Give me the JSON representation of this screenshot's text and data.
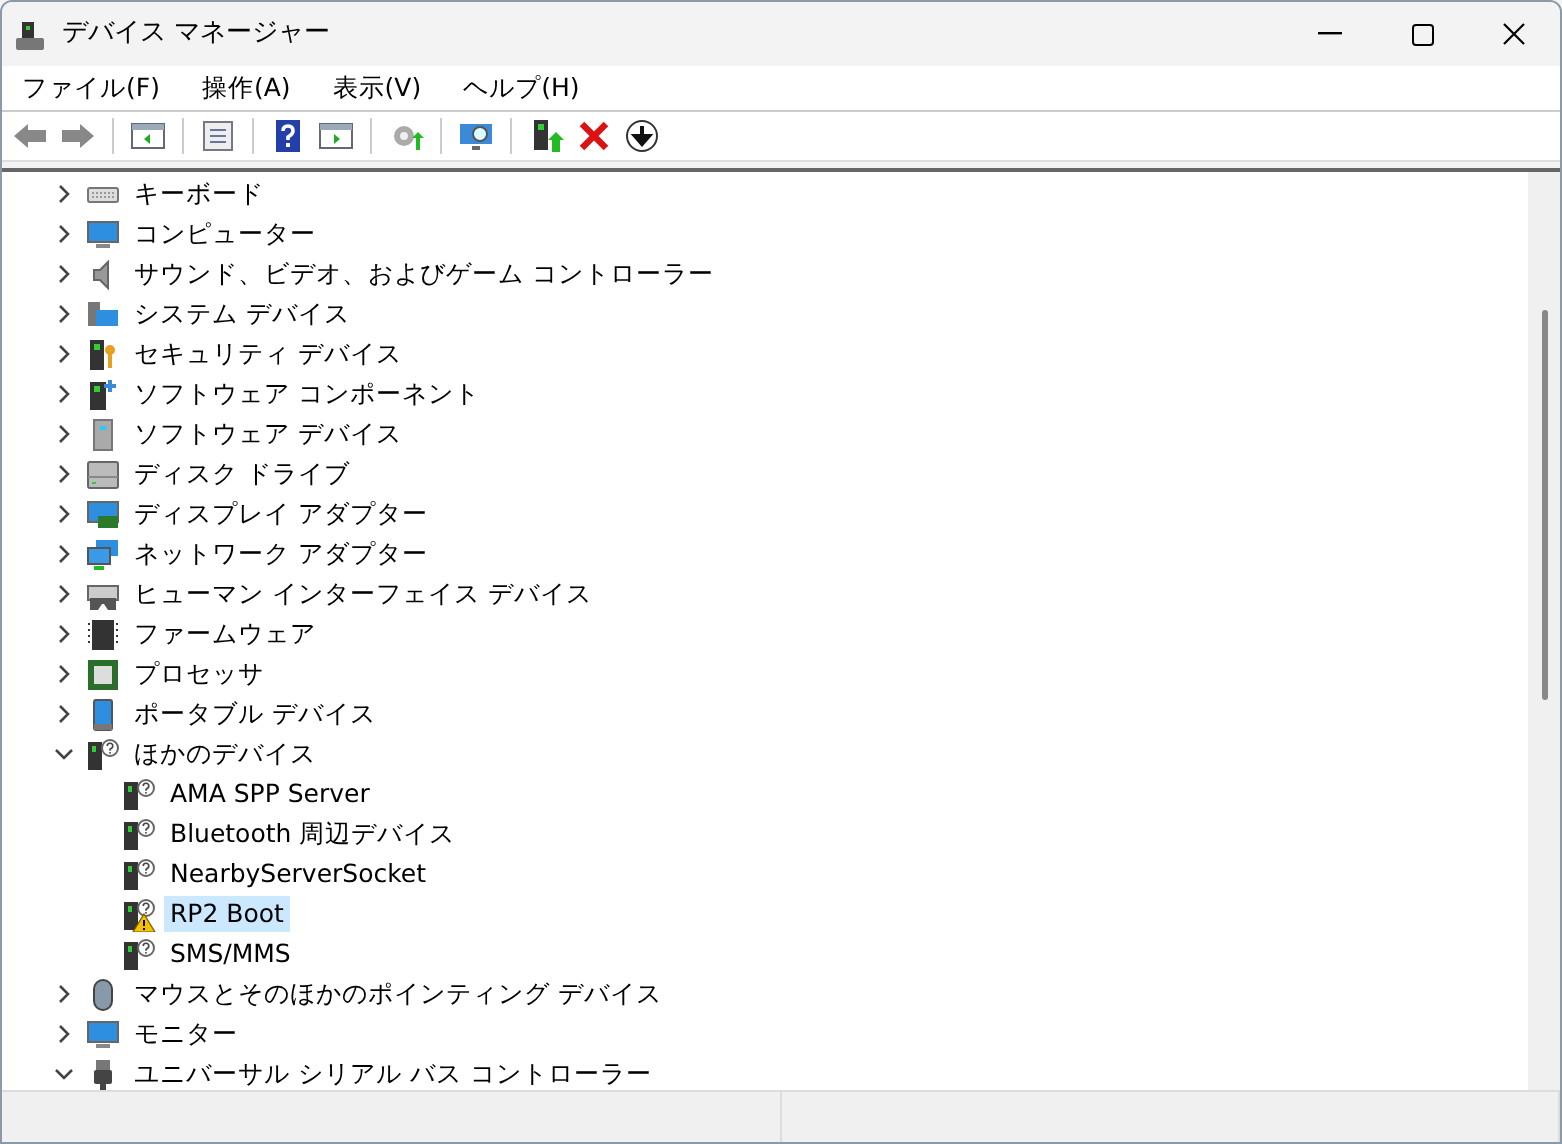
{
  "window": {
    "title": "デバイス マネージャー"
  },
  "menu": [
    "ファイル(F)",
    "操作(A)",
    "表示(V)",
    "ヘルプ(H)"
  ],
  "tree": [
    {
      "label": "キーボード",
      "expanded": false,
      "selected": false
    },
    {
      "label": "コンピューター",
      "expanded": false,
      "selected": false
    },
    {
      "label": "サウンド、ビデオ、およびゲーム コントローラー",
      "expanded": false,
      "selected": false
    },
    {
      "label": "システム デバイス",
      "expanded": false,
      "selected": false
    },
    {
      "label": "セキュリティ デバイス",
      "expanded": false,
      "selected": false
    },
    {
      "label": "ソフトウェア コンポーネント",
      "expanded": false,
      "selected": false
    },
    {
      "label": "ソフトウェア デバイス",
      "expanded": false,
      "selected": false
    },
    {
      "label": "ディスク ドライブ",
      "expanded": false,
      "selected": false
    },
    {
      "label": "ディスプレイ アダプター",
      "expanded": false,
      "selected": false
    },
    {
      "label": "ネットワーク アダプター",
      "expanded": false,
      "selected": false
    },
    {
      "label": "ヒューマン インターフェイス デバイス",
      "expanded": false,
      "selected": false
    },
    {
      "label": "ファームウェア",
      "expanded": false,
      "selected": false
    },
    {
      "label": "プロセッサ",
      "expanded": false,
      "selected": false
    },
    {
      "label": "ポータブル デバイス",
      "expanded": false,
      "selected": false
    },
    {
      "label": "ほかのデバイス",
      "expanded": true,
      "selected": false,
      "children": [
        {
          "label": "AMA SPP Server",
          "selected": false,
          "warning": false
        },
        {
          "label": "Bluetooth 周辺デバイス",
          "selected": false,
          "warning": false
        },
        {
          "label": "NearbyServerSocket",
          "selected": false,
          "warning": false
        },
        {
          "label": "RP2 Boot",
          "selected": true,
          "warning": true
        },
        {
          "label": "SMS/MMS",
          "selected": false,
          "warning": false
        }
      ]
    },
    {
      "label": "マウスとそのほかのポインティング デバイス",
      "expanded": false,
      "selected": false
    },
    {
      "label": "モニター",
      "expanded": false,
      "selected": false
    },
    {
      "label": "ユニバーサル シリアル バス コントローラー",
      "expanded": true,
      "selected": false
    }
  ]
}
